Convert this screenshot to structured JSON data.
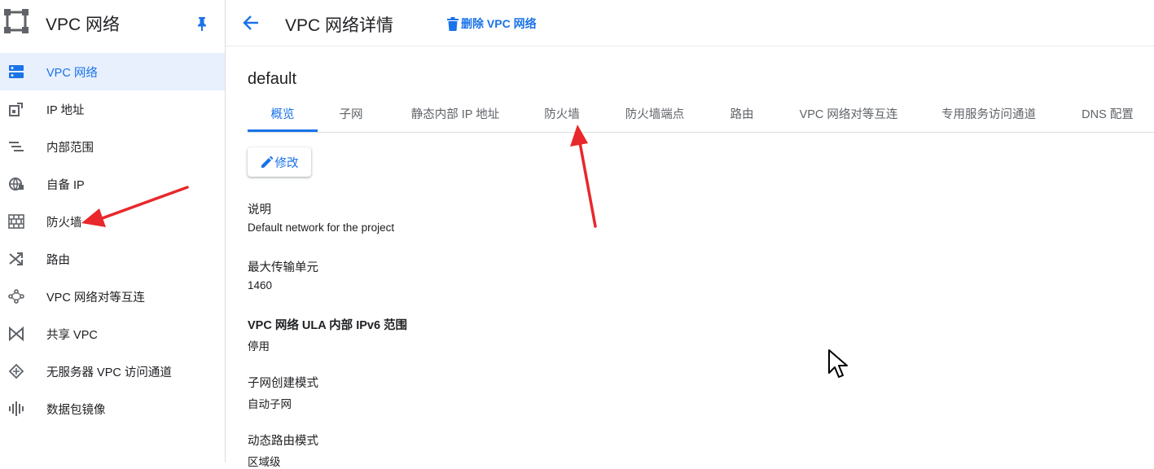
{
  "sidebar": {
    "title": "VPC 网络",
    "items": [
      {
        "label": "VPC 网络",
        "icon": "vpc-network-icon",
        "active": true
      },
      {
        "label": "IP 地址",
        "icon": "ip-address-icon"
      },
      {
        "label": "内部范围",
        "icon": "internal-ranges-icon"
      },
      {
        "label": "自备 IP",
        "icon": "byoip-globe-icon"
      },
      {
        "label": "防火墙",
        "icon": "firewall-icon"
      },
      {
        "label": "路由",
        "icon": "routes-icon"
      },
      {
        "label": "VPC 网络对等互连",
        "icon": "peering-icon"
      },
      {
        "label": "共享 VPC",
        "icon": "shared-vpc-icon"
      },
      {
        "label": "无服务器 VPC 访问通道",
        "icon": "serverless-access-icon"
      },
      {
        "label": "数据包镜像",
        "icon": "packet-mirroring-icon"
      }
    ]
  },
  "header": {
    "title": "VPC 网络详情",
    "delete_label": "删除 VPC 网络"
  },
  "network": {
    "name": "default"
  },
  "tabs": [
    {
      "label": "概览",
      "active": true
    },
    {
      "label": "子网"
    },
    {
      "label": "静态内部 IP 地址"
    },
    {
      "label": "防火墙"
    },
    {
      "label": "防火墙端点"
    },
    {
      "label": "路由"
    },
    {
      "label": "VPC 网络对等互连"
    },
    {
      "label": "专用服务访问通道"
    },
    {
      "label": "DNS 配置"
    }
  ],
  "edit_label": "修改",
  "details": [
    {
      "label": "说明",
      "value": "Default network for the project"
    },
    {
      "label": "最大传输单元",
      "value": "1460"
    },
    {
      "label": "VPC 网络 ULA 内部 IPv6 范围",
      "value": "停用"
    },
    {
      "label": "子网创建模式",
      "value": "自动子网"
    },
    {
      "label": "动态路由模式",
      "value": "区域级"
    }
  ],
  "colors": {
    "accent": "#1a73e8",
    "active_bg": "#e8f0fe",
    "annotation_arrow": "#e8282b"
  }
}
